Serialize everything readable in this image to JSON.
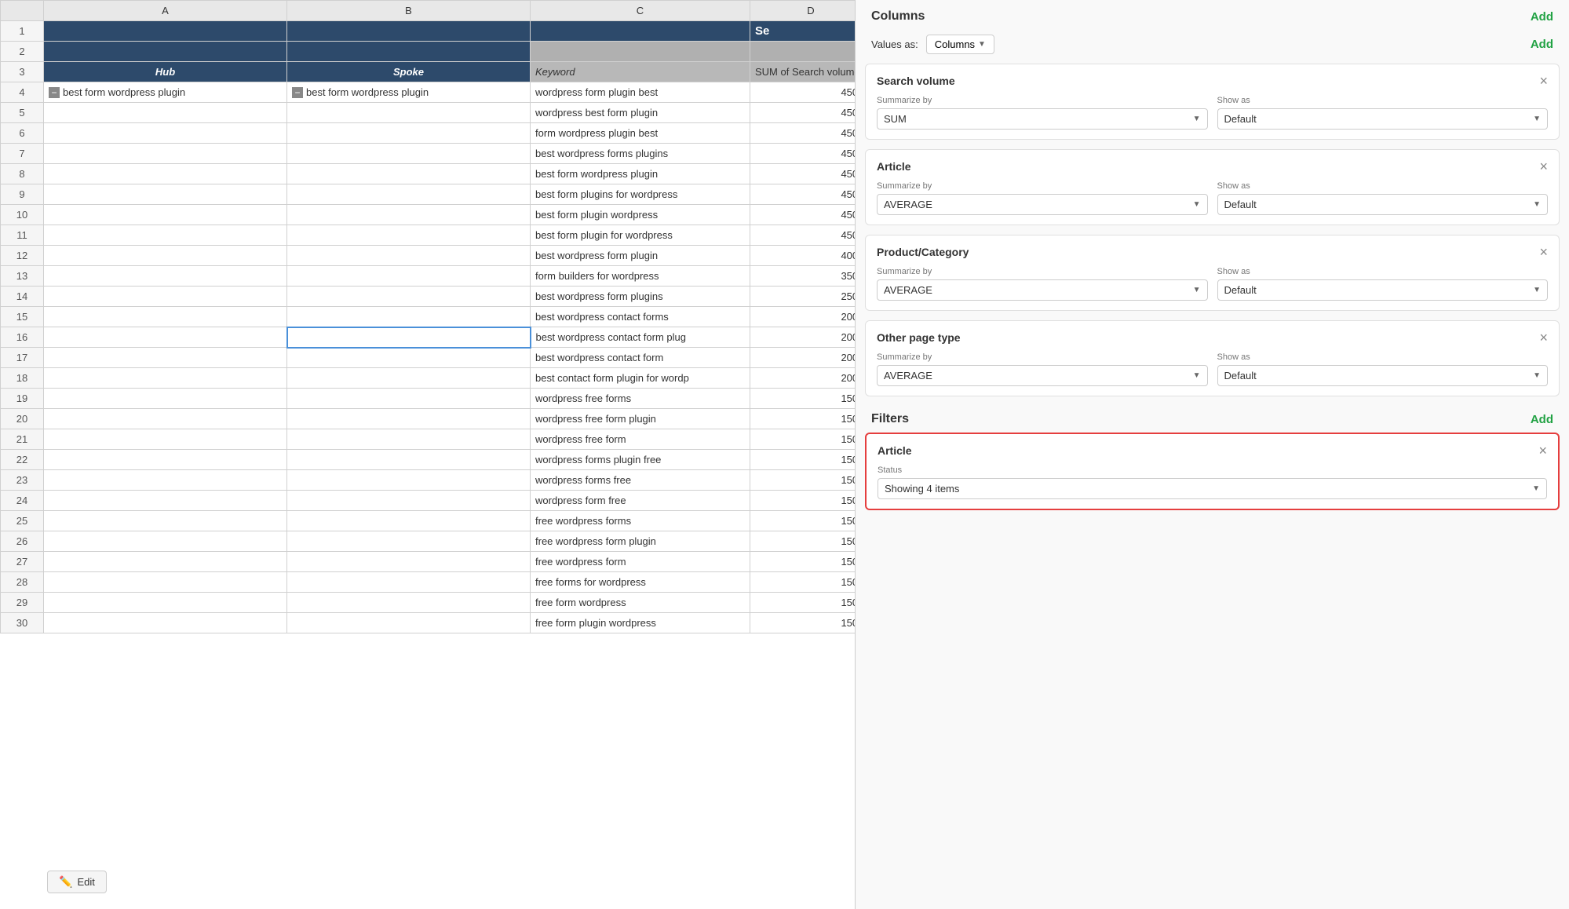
{
  "spreadsheet": {
    "col_headers": [
      "",
      "A",
      "B",
      "C",
      "D"
    ],
    "row1": {
      "hub_text": "",
      "spoke_text": "",
      "keyword_text": "",
      "sum_text": "Se"
    },
    "row2": {
      "hub_text": "",
      "spoke_text": "",
      "keyword_text": "",
      "sum_text": ""
    },
    "row3": {
      "hub_text": "Hub",
      "spoke_text": "Spoke",
      "keyword_text": "Keyword",
      "sum_text": "SUM of Search volume"
    },
    "rows": [
      {
        "row": 4,
        "hub": "best form wordpress plugin",
        "spoke": "best form wordpress plugin",
        "keyword": "wordpress form plugin best",
        "sum": "450.0",
        "selected_col": ""
      },
      {
        "row": 5,
        "hub": "",
        "spoke": "",
        "keyword": "wordpress best form plugin",
        "sum": "450.0"
      },
      {
        "row": 6,
        "hub": "",
        "spoke": "",
        "keyword": "form wordpress plugin best",
        "sum": "450.0"
      },
      {
        "row": 7,
        "hub": "",
        "spoke": "",
        "keyword": "best wordpress forms plugins",
        "sum": "450.0"
      },
      {
        "row": 8,
        "hub": "",
        "spoke": "",
        "keyword": "best form wordpress plugin",
        "sum": "450.0"
      },
      {
        "row": 9,
        "hub": "",
        "spoke": "",
        "keyword": "best form plugins for wordpress",
        "sum": "450.0"
      },
      {
        "row": 10,
        "hub": "",
        "spoke": "",
        "keyword": "best form plugin wordpress",
        "sum": "450.0"
      },
      {
        "row": 11,
        "hub": "",
        "spoke": "",
        "keyword": "best form plugin for wordpress",
        "sum": "450.0"
      },
      {
        "row": 12,
        "hub": "",
        "spoke": "",
        "keyword": "best wordpress form plugin",
        "sum": "400.0"
      },
      {
        "row": 13,
        "hub": "",
        "spoke": "",
        "keyword": "form builders for wordpress",
        "sum": "350.0"
      },
      {
        "row": 14,
        "hub": "",
        "spoke": "",
        "keyword": "best wordpress form plugins",
        "sum": "250.0"
      },
      {
        "row": 15,
        "hub": "",
        "spoke": "",
        "keyword": "best wordpress contact forms",
        "sum": "200.0"
      },
      {
        "row": 16,
        "hub": "",
        "spoke": "",
        "keyword": "best wordpress contact form plug",
        "sum": "200.0",
        "selected_b": true
      },
      {
        "row": 17,
        "hub": "",
        "spoke": "",
        "keyword": "best wordpress contact form",
        "sum": "200.0"
      },
      {
        "row": 18,
        "hub": "",
        "spoke": "",
        "keyword": "best contact form plugin for wordp",
        "sum": "200.0"
      },
      {
        "row": 19,
        "hub": "",
        "spoke": "",
        "keyword": "wordpress free forms",
        "sum": "150.0"
      },
      {
        "row": 20,
        "hub": "",
        "spoke": "",
        "keyword": "wordpress free form plugin",
        "sum": "150.0"
      },
      {
        "row": 21,
        "hub": "",
        "spoke": "",
        "keyword": "wordpress free form",
        "sum": "150.0"
      },
      {
        "row": 22,
        "hub": "",
        "spoke": "",
        "keyword": "wordpress forms plugin free",
        "sum": "150.0"
      },
      {
        "row": 23,
        "hub": "",
        "spoke": "",
        "keyword": "wordpress forms free",
        "sum": "150.0"
      },
      {
        "row": 24,
        "hub": "",
        "spoke": "",
        "keyword": "wordpress form free",
        "sum": "150.0"
      },
      {
        "row": 25,
        "hub": "",
        "spoke": "",
        "keyword": "free wordpress forms",
        "sum": "150.0"
      },
      {
        "row": 26,
        "hub": "",
        "spoke": "",
        "keyword": "free wordpress form plugin",
        "sum": "150.0"
      },
      {
        "row": 27,
        "hub": "",
        "spoke": "",
        "keyword": "free wordpress form",
        "sum": "150.0"
      },
      {
        "row": 28,
        "hub": "",
        "spoke": "",
        "keyword": "free forms for wordpress",
        "sum": "150.0"
      },
      {
        "row": 29,
        "hub": "",
        "spoke": "",
        "keyword": "free form wordpress",
        "sum": "150.0"
      },
      {
        "row": 30,
        "hub": "",
        "spoke": "",
        "keyword": "free form plugin wordpress",
        "sum": "150.0"
      }
    ],
    "edit_button": "Edit"
  },
  "panel": {
    "columns_title": "Columns",
    "add_label": "Add",
    "values_as_label": "Values as:",
    "values_as_option": "Columns",
    "sections": [
      {
        "id": "search_volume",
        "title": "Search volume",
        "summarize_by_label": "Summarize by",
        "summarize_by_value": "SUM",
        "show_as_label": "Show as",
        "show_as_value": "Default"
      },
      {
        "id": "article",
        "title": "Article",
        "summarize_by_label": "Summarize by",
        "summarize_by_value": "AVERAGE",
        "show_as_label": "Show as",
        "show_as_value": "Default"
      },
      {
        "id": "product_category",
        "title": "Product/Category",
        "summarize_by_label": "Summarize by",
        "summarize_by_value": "AVERAGE",
        "show_as_label": "Show as",
        "show_as_value": "Default"
      },
      {
        "id": "other_page_type",
        "title": "Other page type",
        "summarize_by_label": "Summarize by",
        "summarize_by_value": "AVERAGE",
        "show_as_label": "Show as",
        "show_as_value": "Default"
      }
    ],
    "filters_title": "Filters",
    "filters_add": "Add",
    "filter_article": {
      "title": "Article",
      "status_label": "Status",
      "status_value": "Showing 4 items"
    }
  }
}
